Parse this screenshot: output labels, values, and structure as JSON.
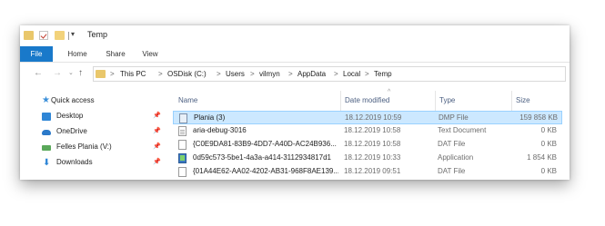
{
  "window": {
    "title": "Temp",
    "dropdown_glyph": "▾"
  },
  "ribbon": {
    "tabs": [
      "File",
      "Home",
      "Share",
      "View"
    ]
  },
  "nav_buttons": {
    "back": "←",
    "forward": "→",
    "recent": "⌄",
    "up": "↑"
  },
  "address": {
    "separator": ">",
    "crumbs": [
      "This PC",
      "OSDisk (C:)",
      "Users",
      "vilmyn",
      "AppData",
      "Local",
      "Temp"
    ]
  },
  "sidebar": {
    "items": [
      {
        "label": "Quick access",
        "icon": "star-icon",
        "pinned": false
      },
      {
        "label": "Desktop",
        "icon": "desktop-icon",
        "pinned": true
      },
      {
        "label": "OneDrive",
        "icon": "cloud-icon",
        "pinned": true
      },
      {
        "label": "Felles Plania (V:)",
        "icon": "network-drive-icon",
        "pinned": true
      },
      {
        "label": "Downloads",
        "icon": "download-icon",
        "pinned": true
      }
    ],
    "pin_glyph": "📌"
  },
  "file_list": {
    "columns": [
      "Name",
      "Date modified",
      "Type",
      "Size"
    ],
    "sort_indicator": "^",
    "rows": [
      {
        "name": "Plania (3)",
        "date": "18.12.2019 10:59",
        "type": "DMP File",
        "size": "159 858 KB",
        "icon": "dmp-file-icon",
        "selected": true
      },
      {
        "name": "aria-debug-3016",
        "date": "18.12.2019 10:58",
        "type": "Text Document",
        "size": "0 KB",
        "icon": "text-file-icon",
        "selected": false
      },
      {
        "name": "{C0E9DA81-83B9-4DD7-A40D-AC24B936...",
        "date": "18.12.2019 10:58",
        "type": "DAT File",
        "size": "0 KB",
        "icon": "file-icon",
        "selected": false
      },
      {
        "name": "0d59c573-5be1-4a3a-a414-3112934817d1",
        "date": "18.12.2019 10:33",
        "type": "Application",
        "size": "1 854 KB",
        "icon": "application-icon",
        "selected": false
      },
      {
        "name": "{01A44E62-AA02-4202-AB31-968F8AE139...",
        "date": "18.12.2019 09:51",
        "type": "DAT File",
        "size": "0 KB",
        "icon": "file-icon",
        "selected": false
      }
    ]
  },
  "colors": {
    "file_tab": "#1979ca",
    "selection_bg": "#cce8ff",
    "selection_border": "#99d1ff",
    "header_text": "#4d6082"
  }
}
